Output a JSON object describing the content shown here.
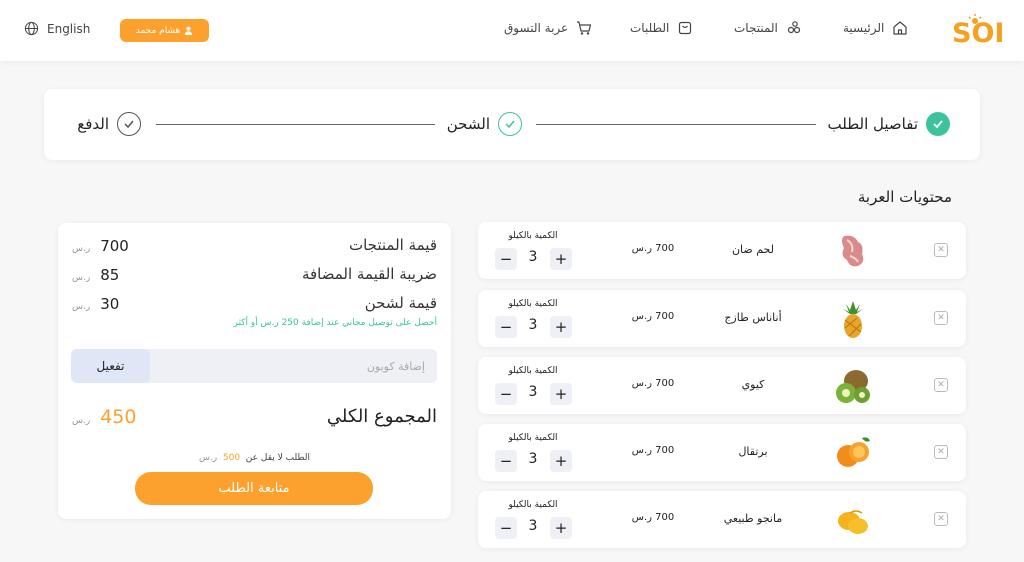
{
  "header": {
    "brand": "SOL",
    "nav": [
      {
        "label": "الرئيسية",
        "icon": "home-icon"
      },
      {
        "label": "المنتجات",
        "icon": "products-icon"
      },
      {
        "label": "الطلبات",
        "icon": "orders-icon"
      },
      {
        "label": "عربة التسوق",
        "icon": "cart-icon"
      }
    ],
    "user_name": "هشام محمد",
    "language": "English",
    "accent_color": "#fca12d"
  },
  "stepper": {
    "steps": [
      {
        "label": "تفاصيل الطلب",
        "state": "completed"
      },
      {
        "label": "الشحن",
        "state": "current"
      },
      {
        "label": "الدفع",
        "state": "pending"
      }
    ],
    "complete_color": "#3cc39d"
  },
  "cart": {
    "title": "محتويات العربة",
    "qty_label": "الكمية بالكيلو",
    "items": [
      {
        "name": "لحم ضان",
        "price": "700 ر.س",
        "qty": "3",
        "image": "meat-image"
      },
      {
        "name": "أناناس طازج",
        "price": "700 ر.س",
        "qty": "3",
        "image": "pineapple-image"
      },
      {
        "name": "كيوي",
        "price": "700 ر.س",
        "qty": "3",
        "image": "kiwi-image"
      },
      {
        "name": "برتقال",
        "price": "700 ر.س",
        "qty": "3",
        "image": "orange-image"
      },
      {
        "name": "مانجو طبيعي",
        "price": "700 ر.س",
        "qty": "3",
        "image": "mango-image"
      }
    ]
  },
  "summary": {
    "rows": [
      {
        "label": "قيمة المنتجات",
        "value": "700",
        "currency": "ر.س"
      },
      {
        "label": "ضريبة القيمة المضافة",
        "value": "85",
        "currency": "ر.س"
      },
      {
        "label": "قيمة لشحن",
        "value": "30",
        "currency": "ر.س"
      }
    ],
    "free_shipping_note": "أحصل على توصيل مجاني عند إضافة 250 ر.س أو أكثر",
    "coupon_placeholder": "إضافة كوبون",
    "coupon_button": "تفعيل",
    "total_label": "المجموع الكلي",
    "total_value": "450",
    "total_currency": "ر.س",
    "min_order_text": "الطلب لا يقل عن",
    "min_order_value": "500",
    "min_order_currency": "ر.س",
    "checkout_button": "متابعة الطلب"
  }
}
